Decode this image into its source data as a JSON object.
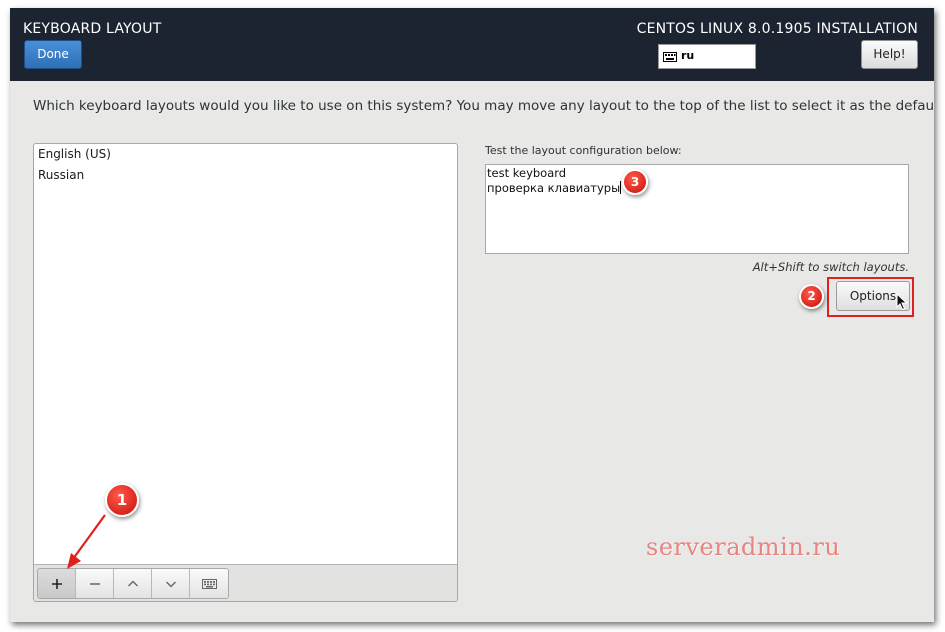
{
  "header": {
    "title": "KEYBOARD LAYOUT",
    "done_label": "Done",
    "product": "CENTOS LINUX 8.0.1905 INSTALLATION",
    "current_layout": "ru",
    "help_label": "Help!"
  },
  "question": "Which keyboard layouts would you like to use on this system?  You may move any layout to the top of the list to select it as the default.",
  "layouts": [
    "English (US)",
    "Russian"
  ],
  "toolbar": {
    "add_label": "+",
    "remove_label": "−",
    "icons": [
      "plus-icon",
      "minus-icon",
      "chevron-up-icon",
      "chevron-down-icon",
      "keyboard-icon"
    ]
  },
  "test": {
    "label": "Test the layout configuration below:",
    "lines": [
      "test keyboard",
      "проверка клавиатуры"
    ]
  },
  "switch_hint": "Alt+Shift to switch layouts.",
  "options_label": "Options",
  "callouts": [
    "1",
    "2",
    "3"
  ],
  "watermark": "serveradmin.ru",
  "colors": {
    "header_bg": "#1c2331",
    "done_button": "#3a7fc9",
    "callout_red": "#e0201c",
    "window_bg": "#e8e8e7"
  }
}
